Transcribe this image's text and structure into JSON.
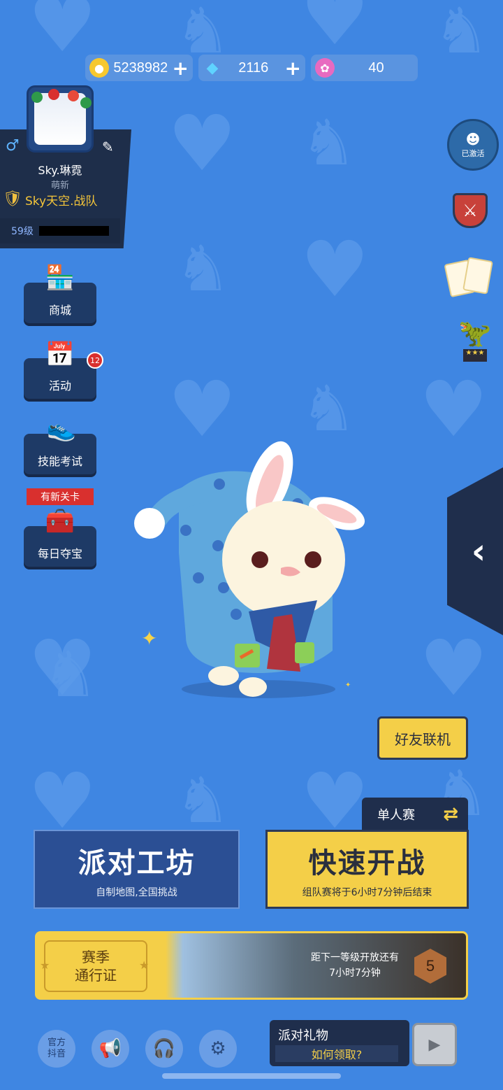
{
  "currency": {
    "coins": "5238982",
    "diamonds": "2116",
    "lotus": "40"
  },
  "profile": {
    "name": "Sky.琳霓",
    "rank": "萌新",
    "team": "Sky天空.战队",
    "level": "59级"
  },
  "menu": {
    "shop": "商城",
    "activity": "活动",
    "activity_badge": "12",
    "skill_test": "技能考试",
    "new_level_tag": "有新关卡",
    "daily_treasure": "每日夺宝"
  },
  "right": {
    "activated": "已激活"
  },
  "friend_button": "好友联机",
  "mode": {
    "label": "单人赛"
  },
  "workshop": {
    "title": "派对工坊",
    "subtitle": "自制地图,全国挑战"
  },
  "quick_battle": {
    "title": "快速开战",
    "subtitle": "组队赛将于6小时7分钟后结束"
  },
  "season_pass": {
    "line1": "赛季",
    "line2": "通行证",
    "info_line1": "距下一等级开放还有",
    "info_line2": "7小时7分钟",
    "level": "5"
  },
  "bottom": {
    "official_line1": "官方",
    "official_line2": "抖音",
    "gift_title": "派对礼物",
    "gift_how": "如何领取?"
  },
  "colors": {
    "background": "#3f86e2",
    "accent_yellow": "#f4cf48",
    "panel_dark": "#1f2e4c",
    "badge_red": "#d9302e"
  }
}
